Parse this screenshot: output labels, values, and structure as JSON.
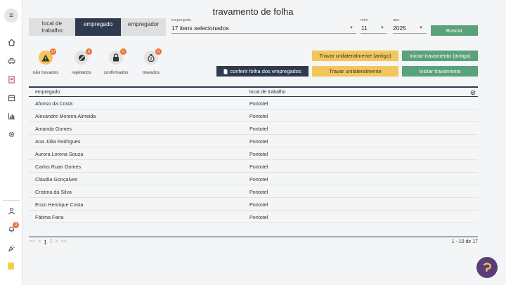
{
  "page": {
    "title": "travamento de folha"
  },
  "segments": {
    "local": "local de trabalho",
    "empregado": "empregado",
    "empregador": "empregador"
  },
  "filters": {
    "empregado": {
      "label": "empregado",
      "value": "17 itens selecionados"
    },
    "mes": {
      "label": "mês",
      "value": "11"
    },
    "ano": {
      "label": "ano",
      "value": "2025"
    },
    "buscar": "Buscar"
  },
  "stats": [
    {
      "label": "não travados",
      "count": "17",
      "icon": "warning-icon"
    },
    {
      "label": "rejeitados",
      "count": "0",
      "icon": "block-icon"
    },
    {
      "label": "confirmados",
      "count": "0",
      "icon": "lock-icon"
    },
    {
      "label": "travados",
      "count": "0",
      "icon": "money-bag-icon"
    }
  ],
  "actions": {
    "travar_antigo": "Travar unilateralmente (antigo)",
    "iniciar_antigo": "Iniciar travamento (antigo)",
    "conferir": "conferir folha dos empregados",
    "travar": "Travar unilateralmente",
    "iniciar": "Iniciar travamento"
  },
  "table": {
    "headers": {
      "empregado": "empregado",
      "local": "local de trabalho"
    },
    "rows": [
      {
        "empregado": "Afonso da Costa",
        "local": "Pontotel"
      },
      {
        "empregado": "Alexandre Moreira Almeida",
        "local": "Pontotel"
      },
      {
        "empregado": "Amanda Gomes",
        "local": "Pontotel"
      },
      {
        "empregado": "Ana Júlia Rodrigues",
        "local": "Pontotel"
      },
      {
        "empregado": "Aurora Lorena Souza",
        "local": "Pontotel"
      },
      {
        "empregado": "Carlos Ruan Gomes",
        "local": "Pontotel"
      },
      {
        "empregado": "Cláudia Gonçalves",
        "local": "Pontotel"
      },
      {
        "empregado": "Cristina da Silva",
        "local": "Pontotel"
      },
      {
        "empregado": "Enzo Henrique Costa",
        "local": "Pontotel"
      },
      {
        "empregado": "Fátima Faria",
        "local": "Pontotel"
      }
    ]
  },
  "pagination": {
    "first": "<<",
    "prev": "<",
    "page1": "1",
    "page2": "2",
    "next": ">",
    "last": ">>",
    "count": "1 - 10 de 17"
  },
  "sidebar": {
    "notif_count": "0"
  },
  "colors": {
    "primary": "#2e3b4e",
    "green": "#5aa27a",
    "yellow": "#f2c65a",
    "badge": "#e8733b",
    "fab": "#5b3d7a"
  }
}
